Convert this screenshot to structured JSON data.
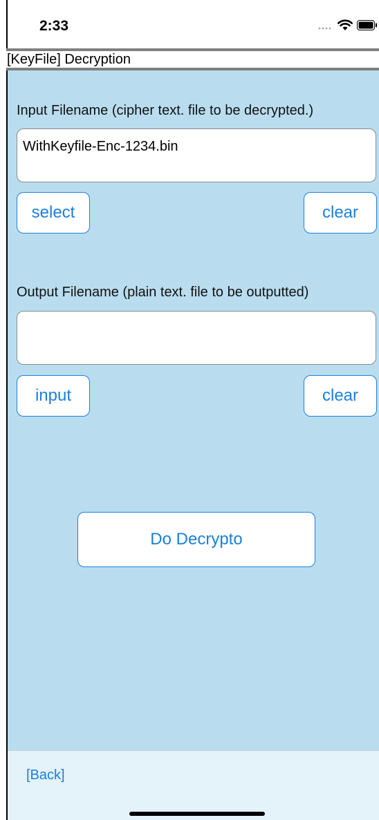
{
  "status_bar": {
    "time": "2:33",
    "icons": [
      "signal-dots-icon",
      "wifi-icon",
      "battery-icon"
    ]
  },
  "title_bar": {
    "title": "[KeyFile] Decryption"
  },
  "input_section": {
    "label": "Input Filename (cipher text. file to be decrypted.)",
    "value": "WithKeyfile-Enc-1234.bin",
    "select_label": "select",
    "clear_label": "clear"
  },
  "output_section": {
    "label": "Output Filename (plain text. file to be outputted)",
    "value": "",
    "input_label": "input",
    "clear_label": "clear"
  },
  "action": {
    "decrypt_label": "Do Decrypto"
  },
  "footer": {
    "back_label": "[Back]"
  },
  "colors": {
    "background": "#b9ddef",
    "footer_background": "#e4f2f9",
    "accent": "#1a7fe0",
    "title_border": "#808080"
  }
}
